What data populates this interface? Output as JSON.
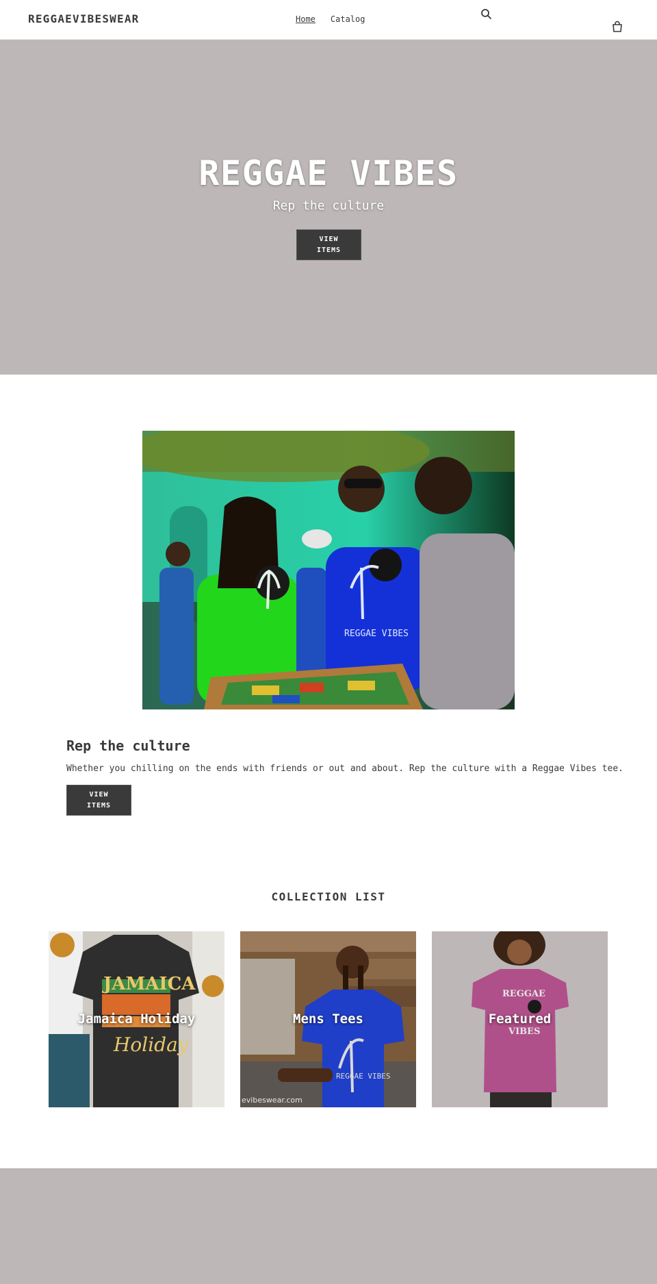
{
  "header": {
    "logo": "REGGAEVIBESWEAR",
    "nav": [
      {
        "label": "Home",
        "active": true
      },
      {
        "label": "Catalog",
        "active": false
      }
    ],
    "icons": [
      "search-icon",
      "cart-icon"
    ]
  },
  "hero": {
    "title": "REGGAE VIBES",
    "subtitle": "Rep the culture",
    "button_line1": "VIEW",
    "button_line2": "ITEMS",
    "background_color": "#bdb7b7"
  },
  "feature": {
    "title": "Rep the culture",
    "body": "Whether you chilling on the ends with friends or out and about. Rep the culture with a Reggae Vibes tee.",
    "button_line1": "VIEW",
    "button_line2": "ITEMS",
    "photo_shirt_text": "REGGAE VIBES"
  },
  "collections": {
    "heading": "COLLECTION LIST",
    "items": [
      {
        "label": "Jamaica Holiday",
        "shirt_line1": "JAMAICA",
        "shirt_line2": "Holiday"
      },
      {
        "label": "Mens Tees",
        "shirt_text": "REGGAE VIBES",
        "watermark": "evibeswear.com"
      },
      {
        "label": "Featured",
        "shirt_line1": "REGGAE",
        "shirt_line2": "VIBES"
      }
    ]
  },
  "colors": {
    "accent": "#3a3a3a",
    "band": "#bdb7b7"
  }
}
